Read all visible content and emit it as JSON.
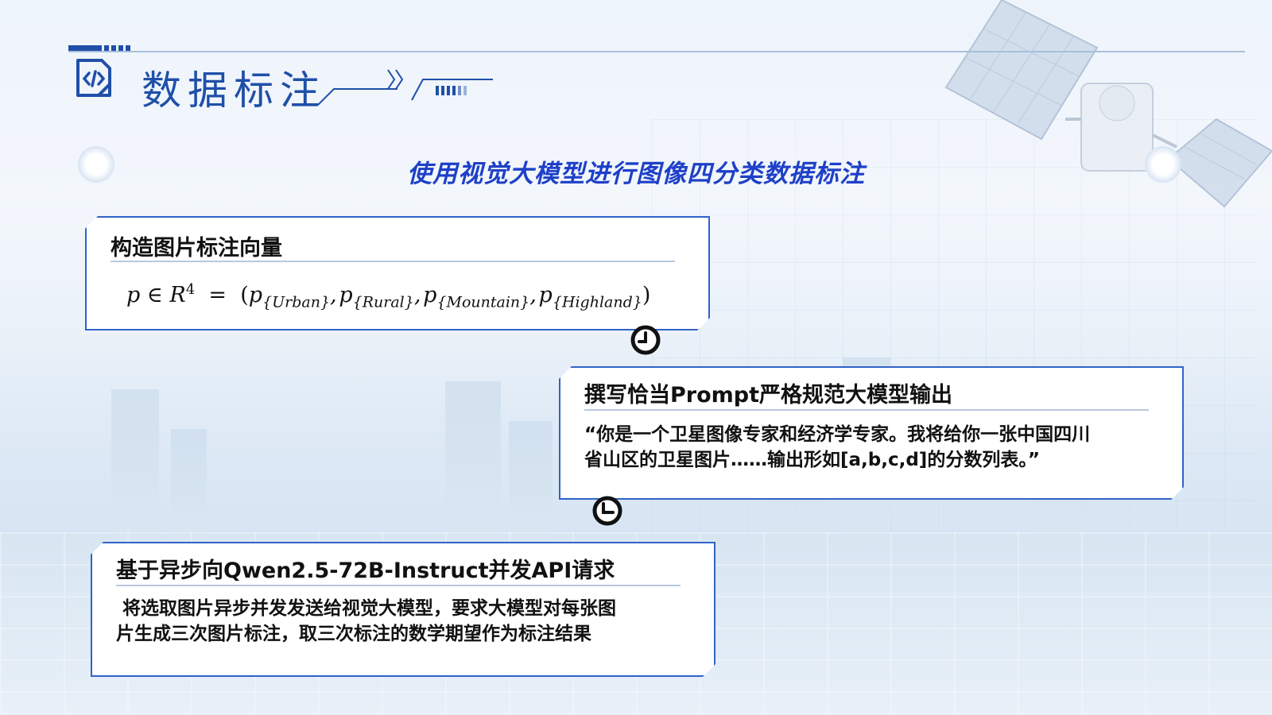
{
  "header": {
    "title": "数据标注"
  },
  "subtitle": "使用视觉大模型进行图像四分类数据标注",
  "colors": {
    "accent": "#1f4fa8",
    "subtitle": "#1e40c8",
    "card_border": "#2f63c8"
  },
  "icons": {
    "title_icon": "code-document-icon",
    "step_icon": "clock-icon"
  },
  "cards": [
    {
      "title": "构造图片标注向量",
      "formula": {
        "lhs": "p ∈ R",
        "exp": "4",
        "eq": "=",
        "open": "(",
        "terms": [
          "p",
          "{Urban}",
          "p",
          "{Rural}",
          "p",
          "{Mountain}",
          "p",
          "{Highland}"
        ],
        "close": ")"
      }
    },
    {
      "title": "撰写恰当Prompt严格规范大模型输出",
      "body_line1": "“你是一个卫星图像专家和经济学专家。我将给你一张中国四川",
      "body_line2": "省山区的卫星图片……输出形如[a,b,c,d]的分数列表。”"
    },
    {
      "title": "基于异步向Qwen2.5-72B-Instruct并发API请求",
      "body_line1": "将选取图片异步并发发送给视觉大模型，要求大模型对每张图",
      "body_line2": "片生成三次图片标注，取三次标注的数学期望作为标注结果"
    }
  ]
}
